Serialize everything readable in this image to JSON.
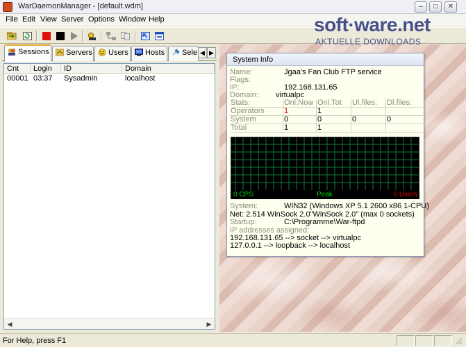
{
  "window": {
    "title": "WarDaemonManager - [default.wdm]",
    "controls": {
      "minimize": "–",
      "maximize": "□",
      "close": "✕"
    }
  },
  "menu": [
    "File",
    "Edit",
    "View",
    "Server",
    "Options",
    "Window",
    "Help"
  ],
  "watermark": {
    "brand": "soft·ware.net",
    "tagline": "AKTUELLE DOWNLOADS"
  },
  "tabs": [
    {
      "label": "Sessions",
      "icon": "sessions-icon",
      "active": true
    },
    {
      "label": "Servers",
      "icon": "servers-icon"
    },
    {
      "label": "Users",
      "icon": "users-icon"
    },
    {
      "label": "Hosts",
      "icon": "hosts-icon"
    },
    {
      "label": "Sele",
      "icon": "select-icon"
    }
  ],
  "sessions": {
    "columns": [
      "Cnt",
      "Login",
      "ID",
      "Domain"
    ],
    "rows": [
      {
        "cnt": "00001",
        "login": "03:37",
        "id": "Sysadmin",
        "domain": "localhost"
      }
    ]
  },
  "system_info": {
    "title": "System Info",
    "fields": {
      "name_label": "Name:",
      "name_value": "Jgaa's Fan Club FTP service",
      "flags_label": "Flags:",
      "ip_label": "IP:",
      "ip_value": "192.168.131.65",
      "domain_label": "Domain:",
      "domain_value": "virtualpc"
    },
    "stats": {
      "headers": [
        "Stats:",
        "Onl.Now",
        "Onl.Tot",
        "Ul.files:",
        "Dl.files:"
      ],
      "rows": [
        [
          "Operators",
          "1",
          "1",
          "",
          ""
        ],
        [
          "System",
          "0",
          "0",
          "0",
          "0"
        ],
        [
          "Total",
          "1",
          "1",
          "",
          ""
        ]
      ]
    },
    "graph": {
      "left": "0 CPS",
      "mid": "Peak",
      "right": "0 Users"
    },
    "details": {
      "system_label": "System:",
      "system_value": "WIN32 (Windows XP 5.1 2600 x86 1-CPU)",
      "net_line": "Net: 2.514 WinSock 2.0\"WinSock 2.0\" (max 0 sockets)",
      "startup_label": "Startup:",
      "startup_value": "C:\\Programme\\War-ftpd",
      "ip_assigned_label": "IP addresses assigned:",
      "ip_lines": [
        "192.168.131.65 --> socket --> virtualpc",
        "127.0.0.1 --> loopback --> localhost"
      ]
    }
  },
  "status": {
    "text": "For Help, press F1"
  },
  "colors": {
    "accent": "#e6a83a",
    "graph_green": "#00d000",
    "graph_red": "#e00000",
    "watermark": "#47508a"
  }
}
